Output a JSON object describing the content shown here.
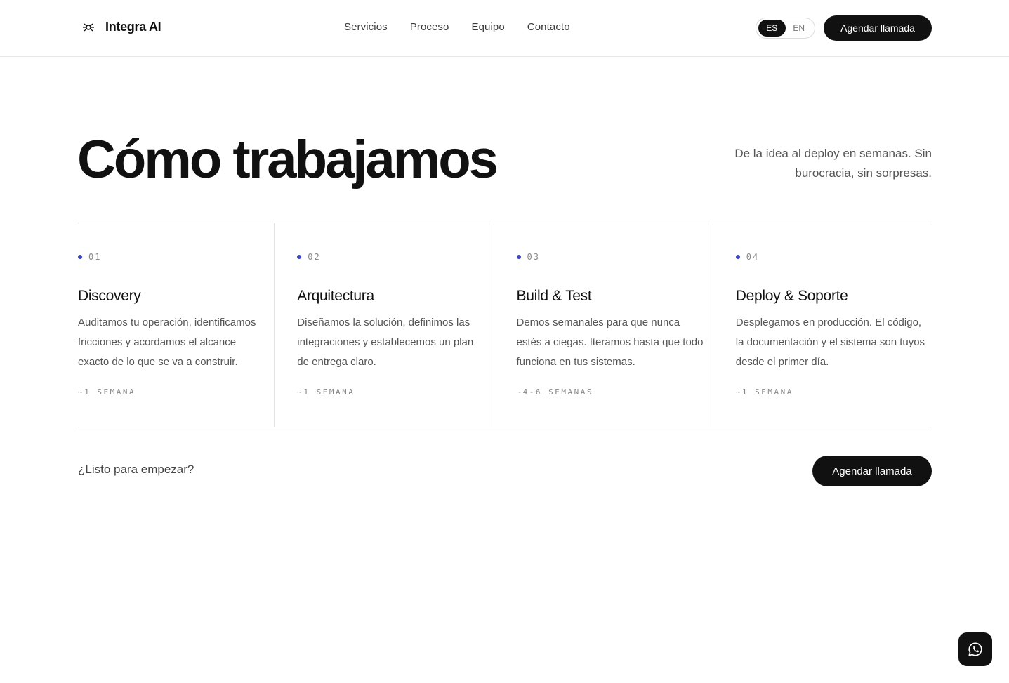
{
  "header": {
    "brand_name": "Integra AI",
    "logo_icon": "integra-logo-icon",
    "nav": [
      "Servicios",
      "Proceso",
      "Equipo",
      "Contacto"
    ],
    "lang_active": "ES",
    "lang_other": "EN",
    "cta_label": "Agendar llamada"
  },
  "hero": {
    "title": "Cómo trabajamos",
    "subtitle": "De la idea al deploy en semanas. Sin burocracia, sin sorpresas."
  },
  "steps": [
    {
      "num": "01",
      "title": "Discovery",
      "desc": "Auditamos tu operación, identificamos fricciones y acordamos el alcance exacto de lo que se va a construir.",
      "duration": "~1 SEMANA"
    },
    {
      "num": "02",
      "title": "Arquitectura",
      "desc": "Diseñamos la solución, definimos las integraciones y establecemos un plan de entrega claro.",
      "duration": "~1 SEMANA"
    },
    {
      "num": "03",
      "title": "Build & Test",
      "desc": "Demos semanales para que nunca estés a ciegas. Iteramos hasta que todo funciona en tus sistemas.",
      "duration": "~4-6 SEMANAS"
    },
    {
      "num": "04",
      "title": "Deploy & Soporte",
      "desc": "Desplegamos en producción. El código, la documentación y el sistema son tuyos desde el primer día.",
      "duration": "~1 SEMANA"
    }
  ],
  "footer_cta": {
    "question": "¿Listo para empezar?",
    "button_label": "Agendar llamada"
  },
  "floating": {
    "icon": "whatsapp-icon"
  },
  "colors": {
    "accent": "#3a44d6",
    "dark": "#111111"
  }
}
